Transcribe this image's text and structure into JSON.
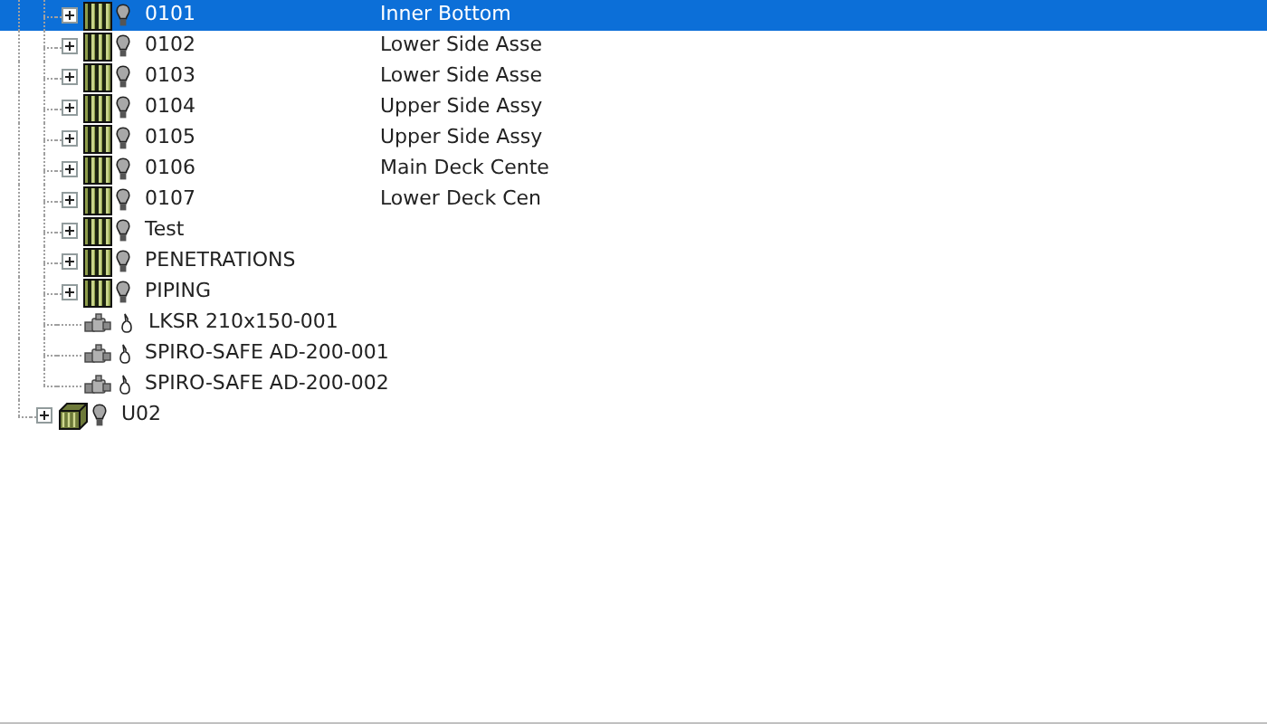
{
  "tree": [
    {
      "kind": "hidden",
      "children": [
        {
          "kind": "assembly",
          "label": "0101",
          "description": "Inner Bottom",
          "expanded": false,
          "selected": true
        },
        {
          "kind": "assembly",
          "label": "0102",
          "description": "Lower Side Asse",
          "expanded": false,
          "selected": false
        },
        {
          "kind": "assembly",
          "label": "0103",
          "description": "Lower Side Asse",
          "expanded": false,
          "selected": false
        },
        {
          "kind": "assembly",
          "label": "0104",
          "description": "Upper Side Assy",
          "expanded": false,
          "selected": false
        },
        {
          "kind": "assembly",
          "label": "0105",
          "description": "Upper Side Assy",
          "expanded": false,
          "selected": false
        },
        {
          "kind": "assembly",
          "label": "0106",
          "description": "Main Deck Cente",
          "expanded": false,
          "selected": false
        },
        {
          "kind": "assembly",
          "label": "0107",
          "description": "Lower Deck Cen",
          "expanded": false,
          "selected": false
        },
        {
          "kind": "assembly",
          "label": "Test",
          "expanded": false,
          "selected": false
        },
        {
          "kind": "assembly",
          "label": "PENETRATIONS",
          "expanded": false,
          "selected": false
        },
        {
          "kind": "assembly",
          "label": "PIPING",
          "expanded": false,
          "selected": false
        },
        {
          "kind": "part",
          "label": "LKSR 210x150-001",
          "selected": false
        },
        {
          "kind": "part",
          "label": "SPIRO-SAFE AD-200-001",
          "selected": false
        },
        {
          "kind": "part",
          "label": "SPIRO-SAFE AD-200-002",
          "selected": false
        }
      ]
    },
    {
      "kind": "unit",
      "label": "U02",
      "expanded": false,
      "selected": false
    }
  ]
}
